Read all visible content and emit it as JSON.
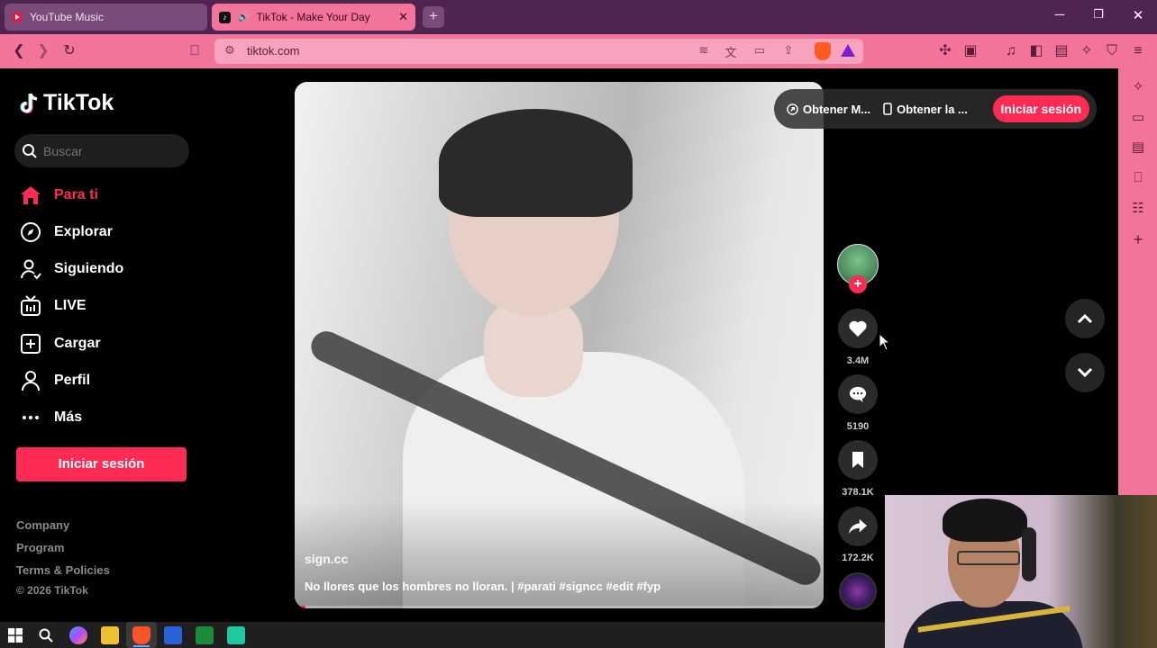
{
  "browser": {
    "tabs": [
      {
        "title": "YouTube Music"
      },
      {
        "title": "TikTok - Make Your Day"
      }
    ],
    "new_tab": "+",
    "url": "tiktok.com"
  },
  "tiktok": {
    "brand": "TikTok",
    "search_placeholder": "Buscar",
    "nav": [
      {
        "label": "Para ti",
        "icon": "home-icon",
        "active": true
      },
      {
        "label": "Explorar",
        "icon": "compass-icon"
      },
      {
        "label": "Siguiendo",
        "icon": "user-follow-icon"
      },
      {
        "label": "LIVE",
        "icon": "live-tv-icon"
      },
      {
        "label": "Cargar",
        "icon": "upload-plus-icon"
      },
      {
        "label": "Perfil",
        "icon": "profile-icon"
      },
      {
        "label": "Más",
        "icon": "more-dots-icon"
      }
    ],
    "login_label": "Iniciar sesión",
    "footer": {
      "company": "Company",
      "program": "Program",
      "terms": "Terms & Policies",
      "copyright": "© 2026 TikTok"
    },
    "topbar": {
      "get_app_1": "Obtener M...",
      "get_app_2": "Obtener la ...",
      "login": "Iniciar sesión"
    },
    "video": {
      "author": "sign.cc",
      "caption": "No llores que los hombres no lloran. | #parati #signcc #edit #fyp",
      "progress": 0.02
    },
    "actions": {
      "likes": "3.4M",
      "comments": "5190",
      "saves": "378.1K",
      "shares": "172.2K"
    }
  },
  "colors": {
    "accent": "#fe2c55",
    "browser_toolbar": "#f2749a",
    "tabstrip": "#4f2451"
  }
}
